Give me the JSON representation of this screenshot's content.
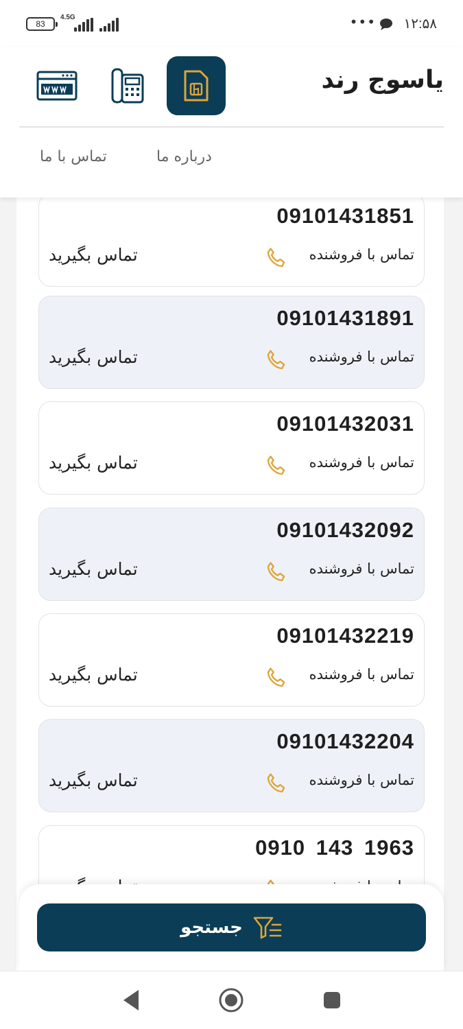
{
  "status_bar": {
    "battery": "83",
    "network": "4.5G",
    "dots": "•••",
    "time": "۱۲:۵۸"
  },
  "header": {
    "title": "یاسوج رند",
    "icons": [
      "sim-card-icon",
      "desk-phone-icon",
      "www-icon"
    ],
    "nav": {
      "about": "درباره ما",
      "contact": "تماس با ما"
    }
  },
  "listings": [
    {
      "number": "09101431851",
      "seller_label": "تماس با فروشنده",
      "call_label": "تماس بگیرید"
    },
    {
      "number": "09101431891",
      "seller_label": "تماس با فروشنده",
      "call_label": "تماس بگیرید"
    },
    {
      "number": "09101432031",
      "seller_label": "تماس با فروشنده",
      "call_label": "تماس بگیرید"
    },
    {
      "number": "09101432092",
      "seller_label": "تماس با فروشنده",
      "call_label": "تماس بگیرید"
    },
    {
      "number": "09101432219",
      "seller_label": "تماس با فروشنده",
      "call_label": "تماس بگیرید"
    },
    {
      "number": "09101432204",
      "seller_label": "تماس با فروشنده",
      "call_label": "تماس بگیرید"
    },
    {
      "number": "0910 143 1963",
      "seller_label": "تماس با فروشنده",
      "call_label": "تماس بگیرید"
    }
  ],
  "search": {
    "label": "جستجو",
    "icon": "filter-icon"
  },
  "colors": {
    "primary": "#0b3d57",
    "accent": "#e0a43a",
    "alt_card": "#eef2f8"
  },
  "nav_bar": {
    "icons": [
      "back-icon",
      "home-icon",
      "recents-icon"
    ]
  }
}
